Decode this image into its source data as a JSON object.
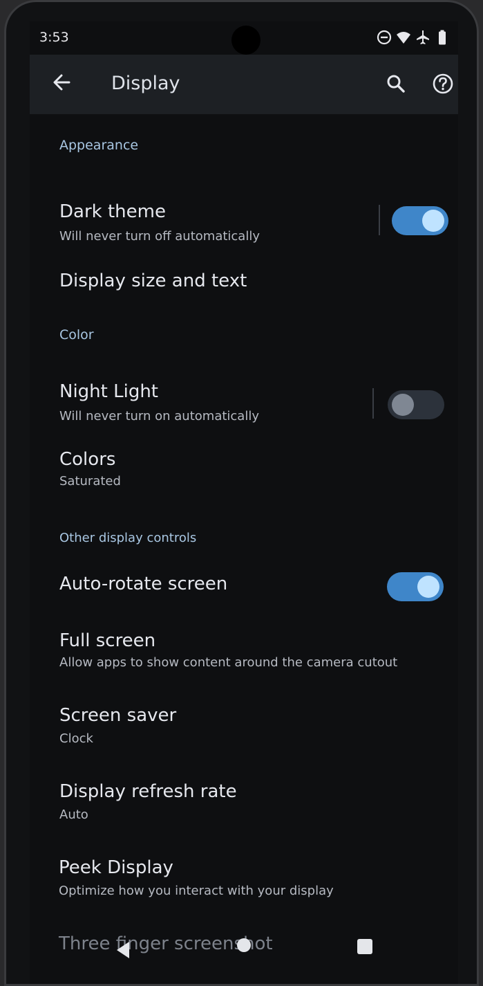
{
  "status_bar": {
    "time": "3:53",
    "icons": [
      "do-not-disturb-icon",
      "wifi-icon",
      "airplane-mode-icon",
      "battery-icon"
    ]
  },
  "app_bar": {
    "title": "Display",
    "back_icon": "arrow-left-icon",
    "search_icon": "search-icon",
    "help_icon": "help-icon"
  },
  "sections": {
    "appearance": "Appearance",
    "color": "Color"
  },
  "items": {
    "dark_theme": {
      "title": "Dark theme",
      "subtitle": "Will never turn off automatically",
      "toggle": true
    },
    "display_size": {
      "title": "Display size and text"
    },
    "night_light": {
      "title": "Night Light",
      "subtitle": "Will never turn on automatically",
      "toggle": false
    },
    "colors": {
      "title": "Colors",
      "subtitle": "Saturated"
    },
    "other_controls": {
      "title": "Other display controls"
    },
    "auto_rotate": {
      "title": "Auto-rotate screen",
      "toggle": true
    },
    "full_screen": {
      "title": "Full screen",
      "subtitle": "Allow apps to show content around the camera cutout"
    },
    "screen_saver": {
      "title": "Screen saver",
      "subtitle": "Clock"
    },
    "refresh_rate": {
      "title": "Display refresh rate",
      "subtitle": "Auto"
    },
    "peek_display": {
      "title": "Peek Display",
      "subtitle": "Optimize how you interact with your display"
    },
    "three_finger": {
      "title": "Three finger screenshot"
    }
  },
  "nav_bar": {
    "back_icon": "triangle-back-icon",
    "home_icon": "home-dot-icon",
    "recents_icon": "square-recents-icon"
  },
  "colors": {
    "accent": "#3f86c9",
    "section_header": "#a9c7e3",
    "background": "#0e0f11"
  }
}
